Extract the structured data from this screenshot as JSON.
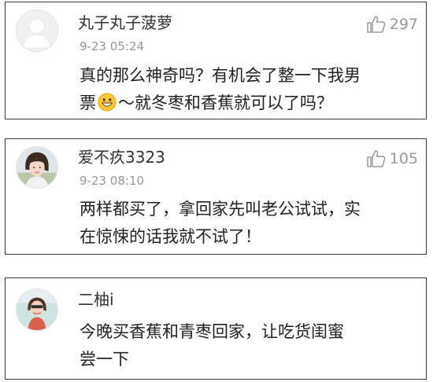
{
  "comments": [
    {
      "username": "丸子丸子菠萝",
      "time": "9-23 05:24",
      "likes": "297",
      "line1": "真的那么神奇吗？有机会了整一下我男",
      "line2_before": "票",
      "emoji": "grinning-face-emoji",
      "line2_after": "～就冬枣和香蕉就可以了吗？",
      "avatar": "default-avatar-icon"
    },
    {
      "username": "爱不疚3323",
      "time": "9-23 08:10",
      "likes": "105",
      "line1": "两样都买了，拿回家先叫老公试试，实",
      "line2": "在惊悚的话我就不试了！",
      "avatar": "user-photo-avatar"
    },
    {
      "username": "二柚i",
      "line1": "今晚买香蕉和青枣回家，让吃货闺蜜",
      "line2": "尝一下",
      "avatar": "user-photo-avatar"
    }
  ],
  "icons": {
    "like": "thumbs-up-icon"
  },
  "colors": {
    "border": "#3a3a3a",
    "meta_text": "#999999",
    "body_text": "#222222"
  }
}
